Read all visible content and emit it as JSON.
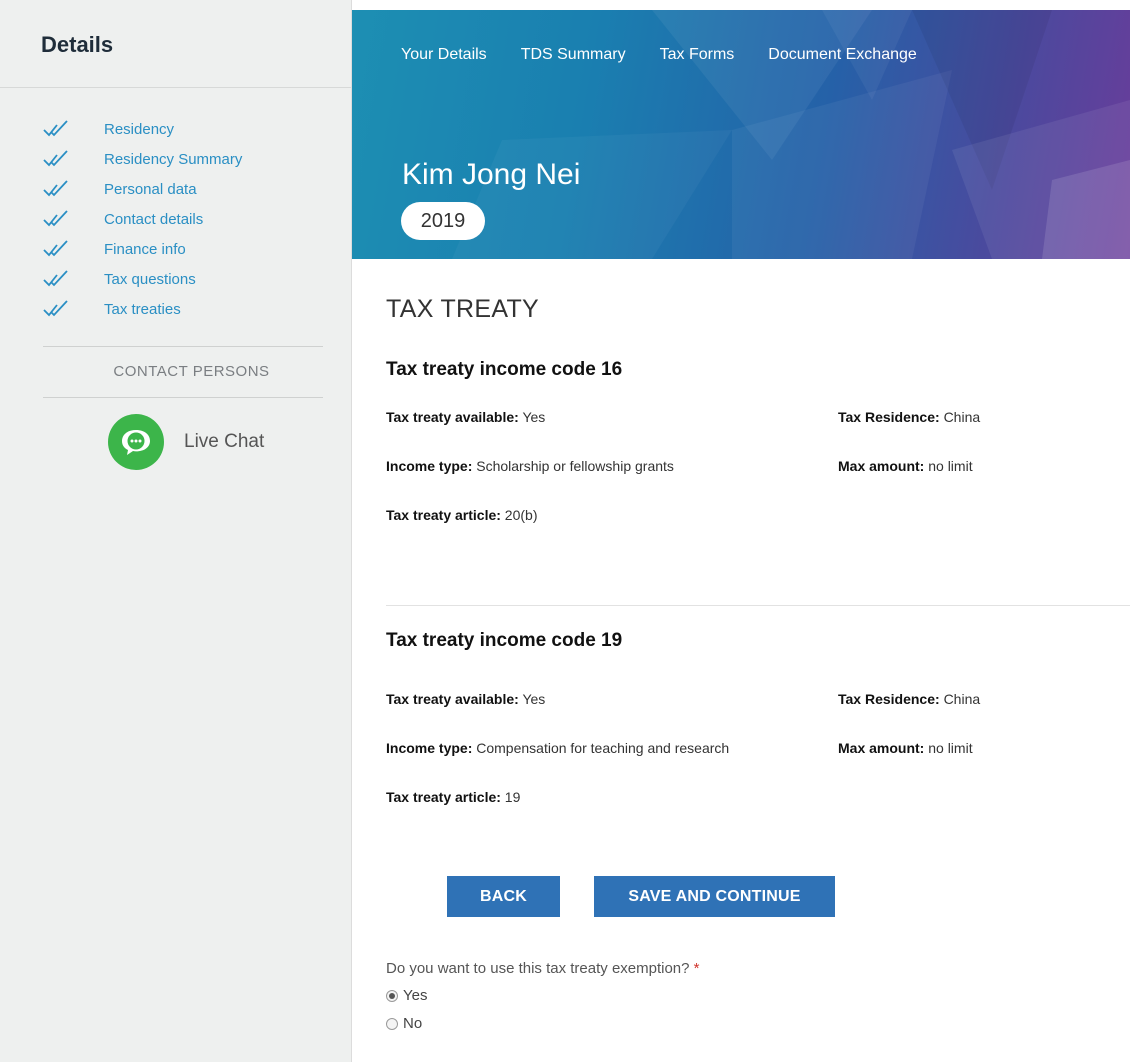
{
  "sidebar": {
    "title": "Details",
    "items": [
      {
        "label": "Residency"
      },
      {
        "label": "Residency Summary"
      },
      {
        "label": "Personal data"
      },
      {
        "label": "Contact details"
      },
      {
        "label": "Finance info"
      },
      {
        "label": "Tax questions"
      },
      {
        "label": "Tax treaties"
      }
    ],
    "contact_title": "CONTACT PERSONS",
    "live_chat_label": "Live Chat"
  },
  "header": {
    "nav": [
      "Your Details",
      "TDS Summary",
      "Tax Forms",
      "Document Exchange"
    ],
    "name": "Kim Jong Nei",
    "year": "2019"
  },
  "main": {
    "section_title": "TAX TREATY",
    "treaties": [
      {
        "heading": "Tax treaty income code 16",
        "available_label": "Tax treaty available:",
        "available": "Yes",
        "residence_label": "Tax Residence:",
        "residence": "China",
        "income_label": "Income type:",
        "income": "Scholarship or fellowship grants",
        "max_label": "Max amount:",
        "max": "no limit",
        "article_label": "Tax treaty article:",
        "article": "20(b)"
      },
      {
        "heading": "Tax treaty income code 19",
        "available_label": "Tax treaty available:",
        "available": "Yes",
        "residence_label": "Tax Residence:",
        "residence": "China",
        "income_label": "Income type:",
        "income": "Compensation for teaching and research",
        "max_label": "Max amount:",
        "max": "no limit",
        "article_label": "Tax treaty article:",
        "article": "19"
      }
    ],
    "back_label": "BACK",
    "save_label": "SAVE AND CONTINUE",
    "question": "Do you want to use this tax treaty exemption?",
    "required_mark": "*",
    "options": [
      {
        "label": "Yes",
        "selected": true
      },
      {
        "label": "No",
        "selected": false
      }
    ]
  },
  "colors": {
    "accent": "#2f72b6",
    "link": "#2a8fc4",
    "chat": "#3cb54a"
  }
}
